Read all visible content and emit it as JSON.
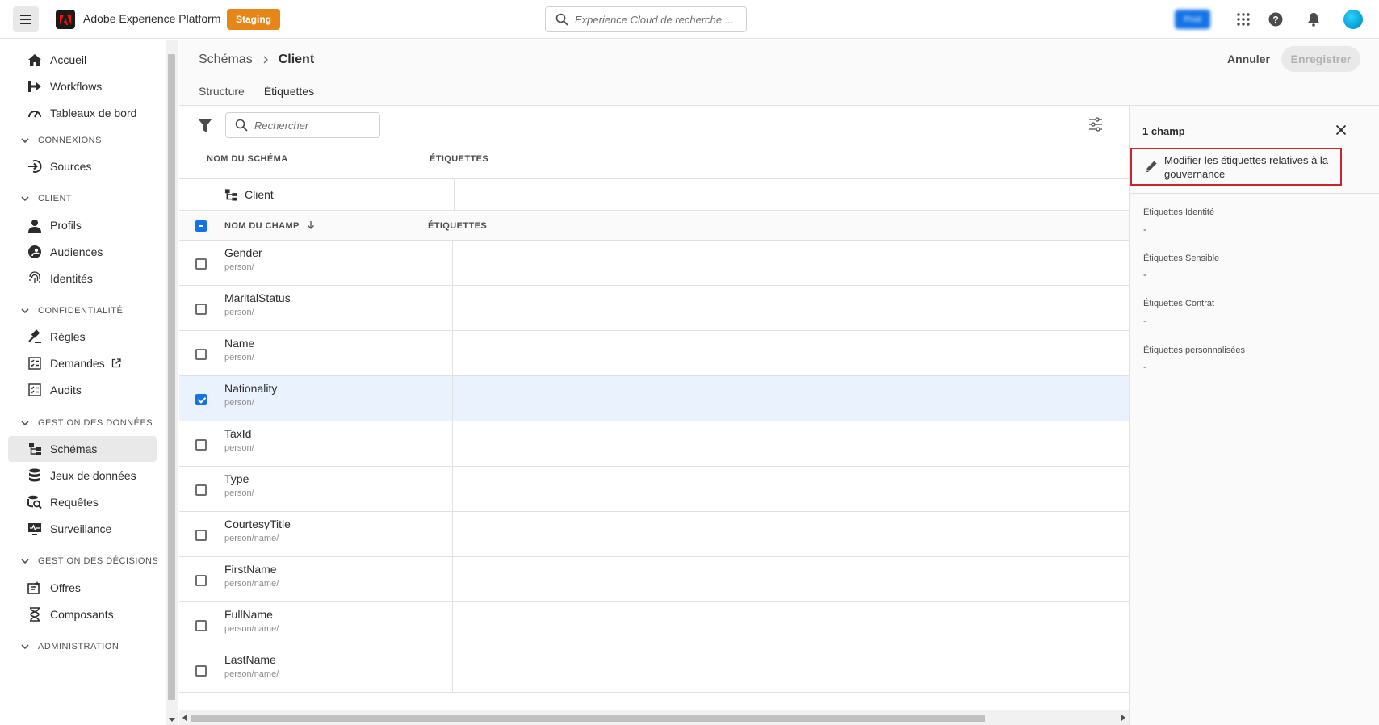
{
  "header": {
    "app_title": "Adobe Experience Platform",
    "env_badge": "Staging",
    "search_placeholder": "Experience Cloud de recherche ...",
    "org_label": "Prod"
  },
  "sidenav": {
    "items": [
      {
        "label": "Accueil",
        "icon": "home-icon"
      },
      {
        "label": "Workflows",
        "icon": "workflow-icon"
      },
      {
        "label": "Tableaux de bord",
        "icon": "dashboard-icon"
      },
      {
        "section": "CONNEXIONS"
      },
      {
        "label": "Sources",
        "icon": "sources-icon"
      },
      {
        "section": "CLIENT"
      },
      {
        "label": "Profils",
        "icon": "person-icon"
      },
      {
        "label": "Audiences",
        "icon": "audiences-icon"
      },
      {
        "label": "Identités",
        "icon": "fingerprint-icon"
      },
      {
        "section": "CONFIDENTIALITÉ"
      },
      {
        "label": "Règles",
        "icon": "gavel-icon"
      },
      {
        "label": "Demandes",
        "icon": "checklist-icon",
        "external": true
      },
      {
        "label": "Audits",
        "icon": "checklist-icon"
      },
      {
        "section": "GESTION DES DONNÉES"
      },
      {
        "label": "Schémas",
        "icon": "schema-icon",
        "selected": true
      },
      {
        "label": "Jeux de données",
        "icon": "database-icon"
      },
      {
        "label": "Requêtes",
        "icon": "query-icon"
      },
      {
        "label": "Surveillance",
        "icon": "monitoring-icon"
      },
      {
        "section": "GESTION DES DÉCISIONS"
      },
      {
        "label": "Offres",
        "icon": "offers-icon"
      },
      {
        "label": "Composants",
        "icon": "components-icon"
      },
      {
        "section": "ADMINISTRATION"
      }
    ]
  },
  "breadcrumb": {
    "parent": "Schémas",
    "current": "Client"
  },
  "actions": {
    "cancel": "Annuler",
    "save": "Enregistrer"
  },
  "tabs": [
    "Structure",
    "Étiquettes"
  ],
  "table": {
    "search_placeholder": "Rechercher",
    "schema_header": {
      "name": "NOM DU SCHÉMA",
      "labels": "ÉTIQUETTES"
    },
    "schema_name": "Client",
    "field_header": {
      "name": "NOM DU CHAMP",
      "labels": "ÉTIQUETTES"
    },
    "rows": [
      {
        "name": "Gender",
        "path": "person/",
        "checked": false
      },
      {
        "name": "MaritalStatus",
        "path": "person/",
        "checked": false
      },
      {
        "name": "Name",
        "path": "person/",
        "checked": false
      },
      {
        "name": "Nationality",
        "path": "person/",
        "checked": true
      },
      {
        "name": "TaxId",
        "path": "person/",
        "checked": false
      },
      {
        "name": "Type",
        "path": "person/",
        "checked": false
      },
      {
        "name": "CourtesyTitle",
        "path": "person/name/",
        "checked": false
      },
      {
        "name": "FirstName",
        "path": "person/name/",
        "checked": false
      },
      {
        "name": "FullName",
        "path": "person/name/",
        "checked": false
      },
      {
        "name": "LastName",
        "path": "person/name/",
        "checked": false
      }
    ]
  },
  "panel": {
    "title": "1 champ",
    "edit_label": "Modifier les étiquettes relatives à la gouvernance",
    "groups": [
      {
        "label": "Étiquettes Identité",
        "value": "-"
      },
      {
        "label": "Étiquettes Sensible",
        "value": "-"
      },
      {
        "label": "Étiquettes Contrat",
        "value": "-"
      },
      {
        "label": "Étiquettes personnalisées",
        "value": "-"
      }
    ]
  }
}
